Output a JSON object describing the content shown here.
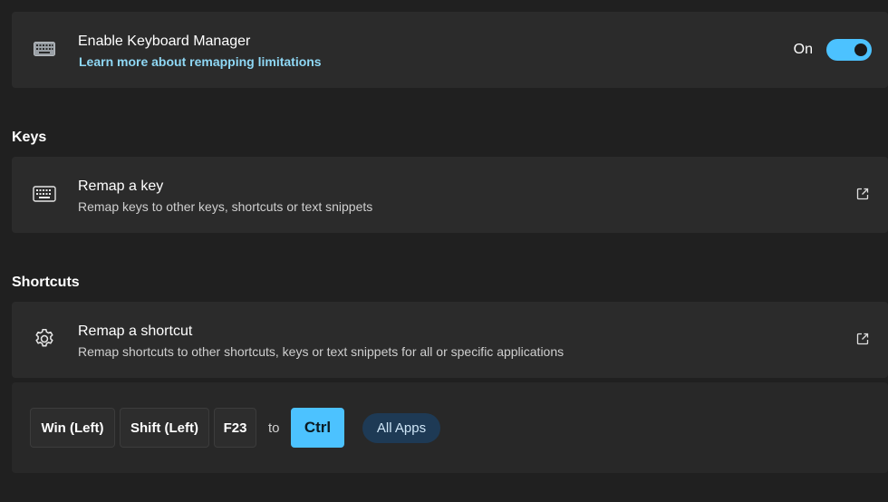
{
  "enable_card": {
    "title": "Enable Keyboard Manager",
    "link": "Learn more about remapping limitations",
    "toggle_label": "On",
    "toggle_on": true,
    "icon": "keyboard-icon"
  },
  "keys_section": {
    "title": "Keys",
    "remap_key": {
      "title": "Remap a key",
      "subtitle": "Remap keys to other keys, shortcuts or text snippets",
      "icon": "keyboard-icon",
      "action_icon": "open-external-icon"
    }
  },
  "shortcuts_section": {
    "title": "Shortcuts",
    "remap_shortcut": {
      "title": "Remap a shortcut",
      "subtitle": "Remap shortcuts to other shortcuts, keys or text snippets for all or specific applications",
      "icon": "gear-icon",
      "action_icon": "open-external-icon"
    },
    "mapping": {
      "from_keys": [
        "Win (Left)",
        "Shift (Left)",
        "F23"
      ],
      "separator": "to",
      "to_keys": [
        "Ctrl"
      ],
      "target_app": "All Apps"
    }
  },
  "colors": {
    "background": "#202020",
    "card": "#2b2b2b",
    "accent": "#4cc2ff",
    "link": "#8fd8f5",
    "app_pill": "#1e3a55"
  }
}
